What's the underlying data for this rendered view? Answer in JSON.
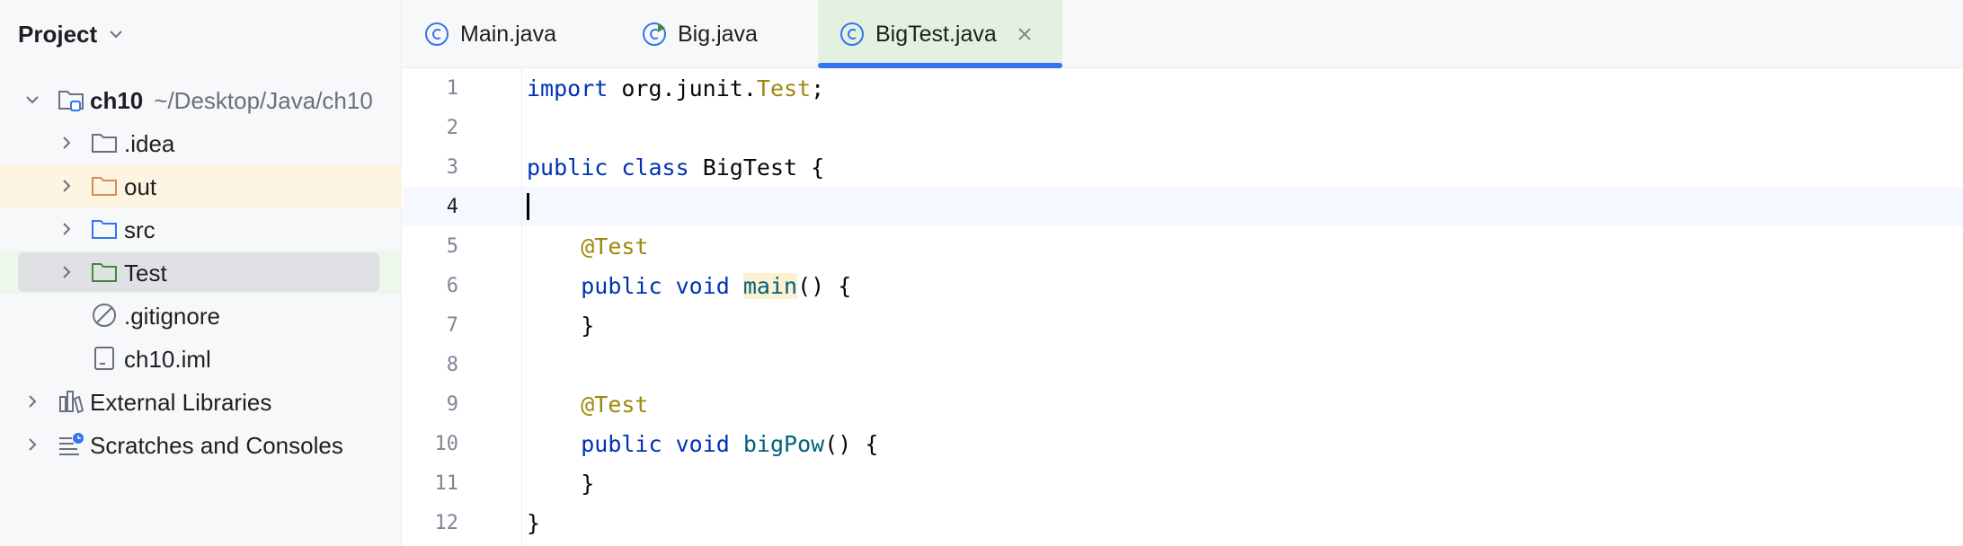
{
  "sidebar": {
    "title": "Project",
    "tree": {
      "root_name": "ch10",
      "root_path": "~/Desktop/Java/ch10",
      "items": [
        {
          "label": ".idea"
        },
        {
          "label": "out"
        },
        {
          "label": "src"
        },
        {
          "label": "Test"
        },
        {
          "label": ".gitignore"
        },
        {
          "label": "ch10.iml"
        }
      ],
      "external_libraries": "External Libraries",
      "scratches": "Scratches and Consoles"
    }
  },
  "tabs": [
    {
      "label": "Main.java",
      "icon": "class-icon"
    },
    {
      "label": "Big.java",
      "icon": "class-run-icon"
    },
    {
      "label": "BigTest.java",
      "icon": "class-icon",
      "active": true
    }
  ],
  "editor": {
    "line_numbers": [
      "1",
      "2",
      "3",
      "4",
      "5",
      "6",
      "7",
      "8",
      "9",
      "10",
      "11",
      "12"
    ],
    "current_line": "4",
    "code": {
      "l1_kw": "import",
      "l1_pkg": " org.junit.",
      "l1_cls": "Test",
      "l1_end": ";",
      "l3_kw1": "public",
      "l3_kw2": "class",
      "l3_rest": " BigTest {",
      "l5_ann": "@Test",
      "l6_kw1": "public",
      "l6_kw2": "void",
      "l6_fn": "main",
      "l6_rest": "() {",
      "l7": "}",
      "l9_ann": "@Test",
      "l10_kw1": "public",
      "l10_kw2": "void",
      "l10_fn": "bigPow",
      "l10_rest": "() {",
      "l11": "}",
      "l12": "}"
    }
  },
  "colors": {
    "keyword": "#0033b3",
    "annotation": "#9e880d",
    "method": "#00627a",
    "accent": "#3574f0"
  }
}
